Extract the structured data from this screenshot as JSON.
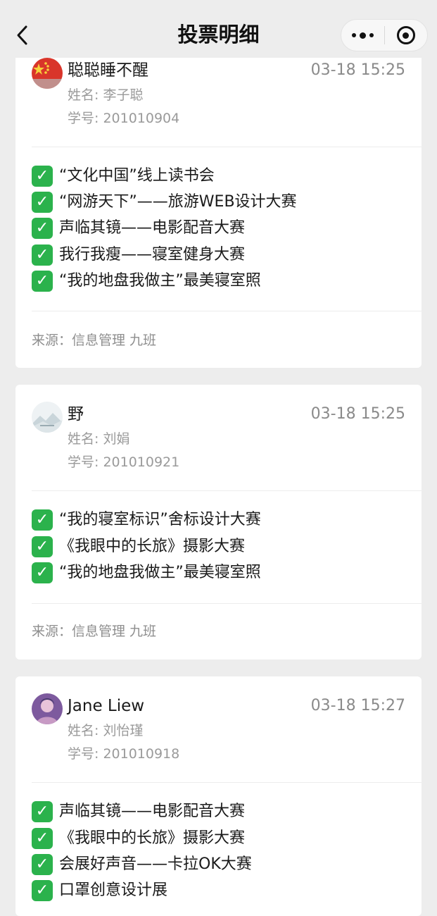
{
  "nav": {
    "title": "投票明细"
  },
  "colors": {
    "background": "#ededed",
    "check": "#2bb24c"
  },
  "cards": [
    {
      "nickname": "聪聪睡不醒",
      "time": "03-18 15:25",
      "name": "姓名: 李子聪",
      "student_id": "学号: 201010904",
      "votes": [
        "“文化中国”线上读书会",
        "“网游天下”——旅游WEB设计大赛",
        "声临其镜——电影配音大赛",
        "我行我瘦——寝室健身大赛",
        "“我的地盘我做主”最美寝室照"
      ],
      "source": "来源：信息管理 九班"
    },
    {
      "nickname": "野",
      "time": "03-18 15:25",
      "name": "姓名: 刘娟",
      "student_id": "学号: 201010921",
      "votes": [
        "“我的寝室标识”舍标设计大赛",
        "《我眼中的长旅》摄影大赛",
        "“我的地盘我做主”最美寝室照"
      ],
      "source": "来源：信息管理 九班"
    },
    {
      "nickname": "Jane Liew",
      "time": "03-18 15:27",
      "name": "姓名: 刘怡瑾",
      "student_id": "学号: 201010918",
      "votes": [
        "声临其镜——电影配音大赛",
        "《我眼中的长旅》摄影大赛",
        "会展好声音——卡拉OK大赛",
        "口罩创意设计展"
      ],
      "source": ""
    }
  ]
}
